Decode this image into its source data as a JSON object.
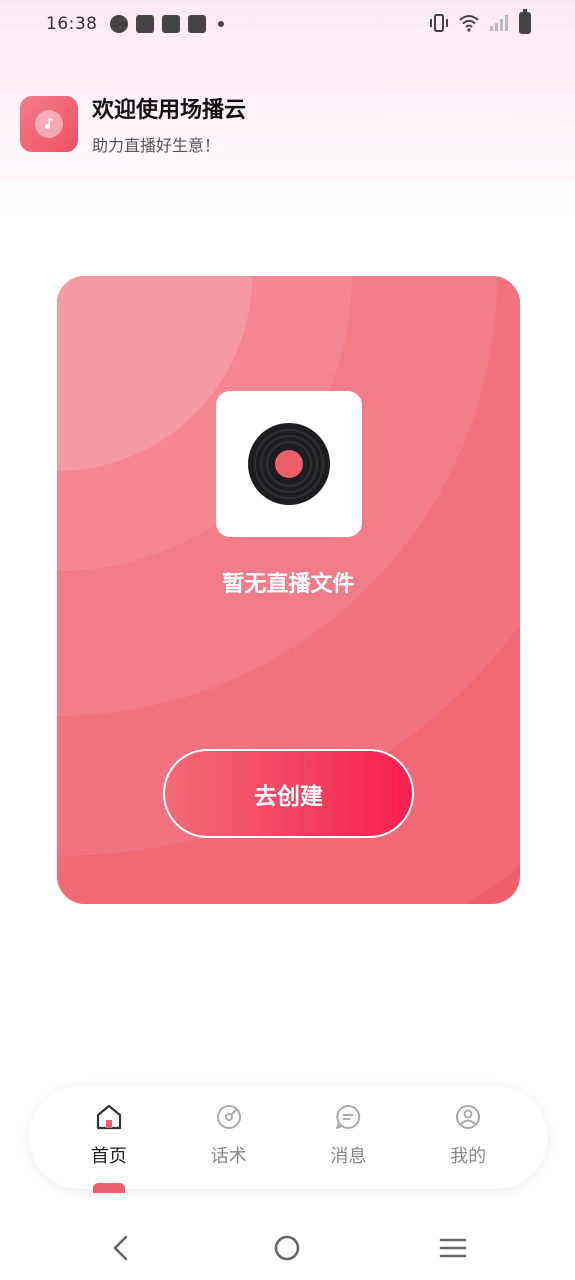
{
  "status_bar": {
    "time": "16:38"
  },
  "header": {
    "title": "欢迎使用场播云",
    "subtitle": "助力直播好生意！"
  },
  "card": {
    "empty_text": "暂无直播文件",
    "create_label": "去创建"
  },
  "tabs": [
    {
      "label": "首页",
      "icon": "home-icon",
      "active": true
    },
    {
      "label": "话术",
      "icon": "script-icon",
      "active": false
    },
    {
      "label": "消息",
      "icon": "message-icon",
      "active": false
    },
    {
      "label": "我的",
      "icon": "profile-icon",
      "active": false
    }
  ],
  "colors": {
    "accent": "#ee5f6d",
    "button_gradient_end": "#f51f4f"
  }
}
